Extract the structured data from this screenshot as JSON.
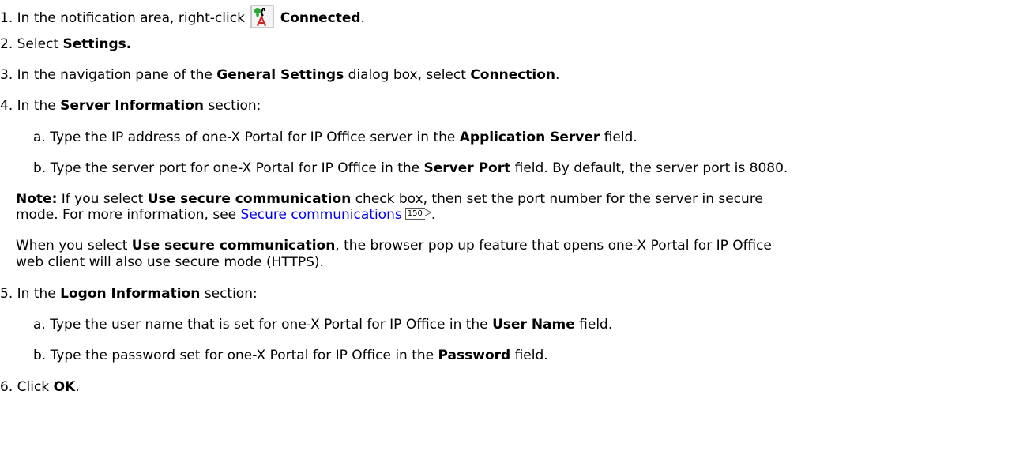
{
  "steps": {
    "s1": {
      "num": "1.",
      "pre": "In the notification area, right-click",
      "icon": "connected-status-icon",
      "bold": "Connected",
      "post": "."
    },
    "s2": {
      "num": "2.",
      "pre": "Select",
      "bold": "Settings."
    },
    "s3": {
      "num": "3.",
      "pre": "In the navigation pane of the",
      "bold1": "General Settings",
      "mid": "dialog box, select",
      "bold2": "Connection",
      "post": "."
    },
    "s4": {
      "num": "4.",
      "pre": "In the",
      "bold": "Server Information",
      "post": "section:",
      "a": {
        "pre": "a. Type the IP address of one-X Portal for IP Office server in the",
        "bold": "Application Server",
        "post": "field."
      },
      "b": {
        "pre": "b. Type the server port for one-X Portal for IP Office in the",
        "bold": "Server Port",
        "post": "field. By default, the server port is 8080."
      },
      "note": {
        "label": "Note:",
        "pre": "If you select",
        "bold": "Use secure communication",
        "post": "check box, then set the port number for the server in secure",
        "line2_pre": "mode. For more information, see",
        "link": "Secure communications",
        "page": "150",
        "line2_post": "."
      },
      "when": {
        "pre": "When you select",
        "bold": "Use secure communication",
        "post": ", the browser pop up  feature that opens one-X Portal for IP Office",
        "line2": "web client will also use secure mode (HTTPS)."
      }
    },
    "s5": {
      "num": "5.",
      "pre": "In the",
      "bold": "Logon Information",
      "post": "section:",
      "a": {
        "pre": "a. Type the user name that is set for one-X Portal for IP Office in the",
        "bold": "User Name",
        "post": "field."
      },
      "b": {
        "pre": "b. Type the password set for one-X Portal for IP Office in the",
        "bold": "Password",
        "post": "field."
      }
    },
    "s6": {
      "num": "6.",
      "pre": "Click",
      "bold": "OK",
      "post": "."
    }
  },
  "colors": {
    "link": "#0000ee",
    "icon_green": "#22aa33",
    "icon_red": "#cc2222"
  }
}
